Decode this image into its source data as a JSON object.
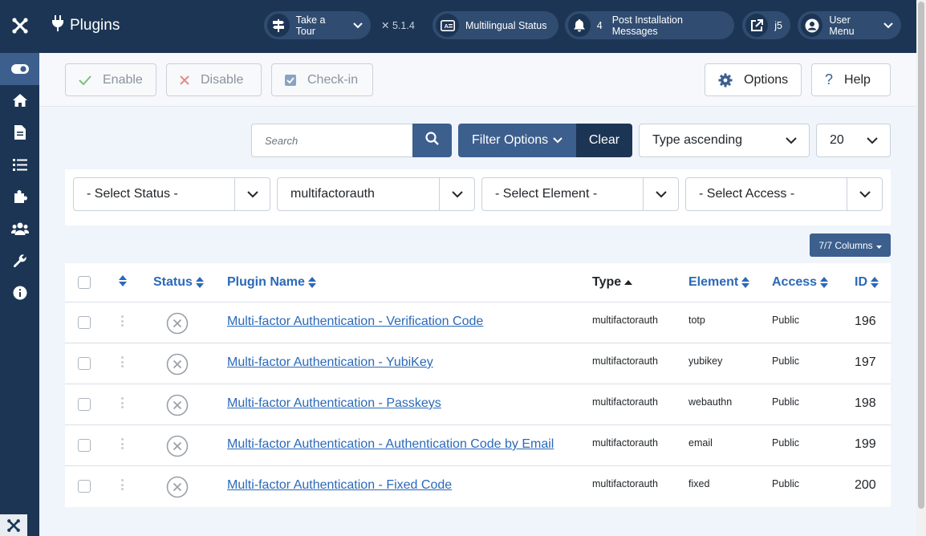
{
  "header": {
    "title": "Plugins",
    "take_tour": "Take a Tour",
    "version": "5.1.4",
    "multilingual": "Multilingual Status",
    "post_install_count": "4",
    "post_install": "Post Installation Messages",
    "site_link": "j5",
    "user_menu": "User Menu"
  },
  "toolbar": {
    "enable": "Enable",
    "disable": "Disable",
    "checkin": "Check-in",
    "options": "Options",
    "help": "Help"
  },
  "search": {
    "placeholder": "Search",
    "filter_options": "Filter Options",
    "clear": "Clear",
    "ordering": "Type ascending",
    "limit": "20"
  },
  "filters": {
    "status": "- Select Status -",
    "folder": "multifactorauth",
    "element": "- Select Element -",
    "access": "- Select Access -"
  },
  "columns_button": "7/7 Columns",
  "table": {
    "headers": {
      "status": "Status",
      "name": "Plugin Name",
      "type": "Type",
      "element": "Element",
      "access": "Access",
      "id": "ID"
    },
    "rows": [
      {
        "name": "Multi-factor Authentication - Verification Code",
        "type": "multifactorauth",
        "element": "totp",
        "access": "Public",
        "id": "196"
      },
      {
        "name": "Multi-factor Authentication - YubiKey",
        "type": "multifactorauth",
        "element": "yubikey",
        "access": "Public",
        "id": "197"
      },
      {
        "name": "Multi-factor Authentication - Passkeys",
        "type": "multifactorauth",
        "element": "webauthn",
        "access": "Public",
        "id": "198"
      },
      {
        "name": "Multi-factor Authentication - Authentication Code by Email",
        "type": "multifactorauth",
        "element": "email",
        "access": "Public",
        "id": "199"
      },
      {
        "name": "Multi-factor Authentication - Fixed Code",
        "type": "multifactorauth",
        "element": "fixed",
        "access": "Public",
        "id": "200"
      }
    ]
  },
  "colors": {
    "navy": "#1c3554",
    "accent": "#3c5f8d",
    "link": "#2a69b8"
  }
}
